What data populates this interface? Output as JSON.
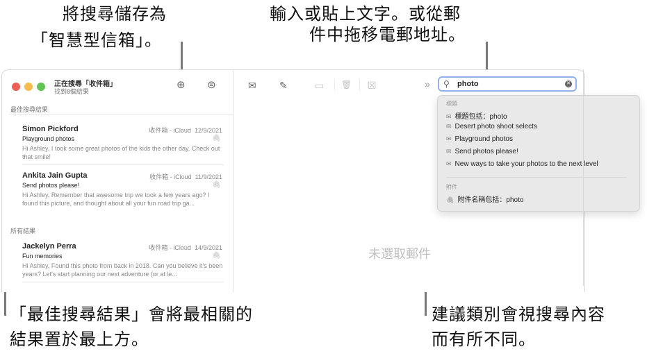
{
  "callouts": {
    "smart_mailbox": [
      "將搜尋儲存為",
      "「智慧型信箱」。"
    ],
    "search_field": [
      "輸入或貼上文字。或從郵",
      "件中拖移電郵地址。"
    ],
    "top_hits": [
      "「最佳搜尋結果」會將最相關的",
      "結果置於最上方。"
    ],
    "suggestions": [
      "建議類別會視搜尋內容",
      "而有所不同。"
    ]
  },
  "window": {
    "title": "正在搜尋「收件箱」",
    "subtitle": "找到8個結果",
    "traffic_colors": [
      "#ee5f57",
      "#f5bd4f",
      "#61c454"
    ]
  },
  "sidebar": {
    "top_hits_label": "最佳搜尋結果",
    "all_results_label": "所有結果",
    "messages": [
      {
        "sender": "Simon Pickford",
        "mailbox": "收件箱 - iCloud",
        "date": "12/9/2021",
        "subject": "Playground photos",
        "preview": "Hi Ashley, I took some great photos of the kids the other day. Check out that smile!"
      },
      {
        "sender": "Ankita Jain Gupta",
        "mailbox": "收件箱 - iCloud",
        "date": "11/9/2021",
        "subject": "Send photos please!",
        "preview": "Hi Ashley, Remember that awesome trip we took a few years ago? I found this picture, and thought about all your fun road trip ga..."
      },
      {
        "sender": "Jackelyn Perra",
        "mailbox": "收件箱 - iCloud",
        "date": "14/9/2021",
        "subject": "Fun memories",
        "preview": "Hi Ashley, Found this photo from back in 2018. Can you believe it's been years? Let's start planning our next adventure (or at le..."
      }
    ]
  },
  "toolbar": {
    "search_value": "photo",
    "overflow_label": "»"
  },
  "viewer": {
    "empty_label": "未選取郵件"
  },
  "suggestions": {
    "subject_header": "標題",
    "subject_items": [
      "標題包括：photo",
      "Desert photo shoot selects",
      "Playground photos",
      "Send photos please!",
      "New ways to take your photos to the next level"
    ],
    "attachment_header": "附件",
    "attachment_items": [
      "附件名稱包括：photo"
    ]
  },
  "icons": {
    "add": "⊕",
    "filter": "⊜",
    "mail": "✉",
    "compose": "✎",
    "archive": "▭",
    "trash": "🗑",
    "junk": "☒",
    "search": "⚲",
    "clear": "✕",
    "paperclip": "🖇"
  }
}
